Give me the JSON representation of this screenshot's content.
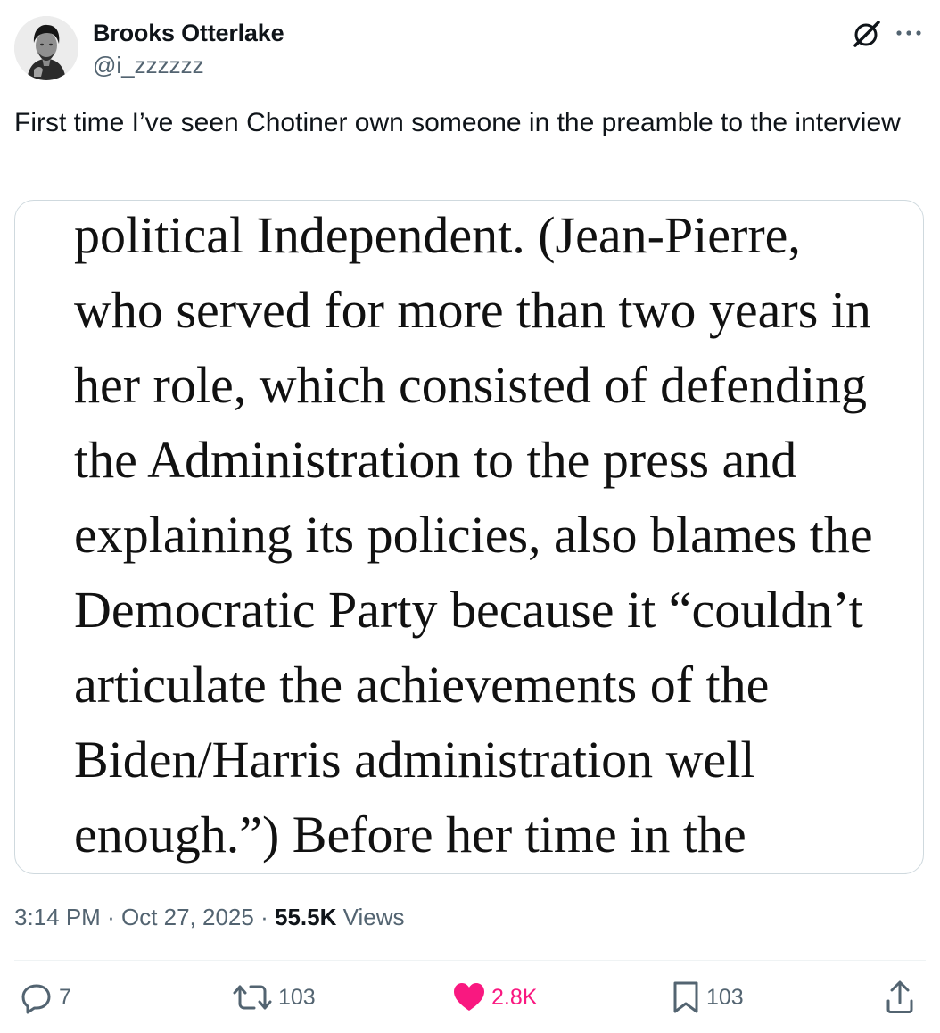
{
  "tweet": {
    "author": {
      "display_name": "Brooks Otterlake",
      "handle": "@i_zzzzzz"
    },
    "text": "First time I’ve seen Chotiner own someone in the preamble to the interview",
    "image_text_lines": [
      "political Independent. (Jean-Pierre,",
      "who served for more than two years in",
      "her role, which consisted of defending",
      "the Administration to the press and",
      "explaining its policies, also blames the",
      "Democratic Party because it “couldn’t",
      "articulate the achievements of the",
      "Biden/Harris administration well",
      "enough.”) Before her time in the"
    ],
    "meta": {
      "time": "3:14 PM",
      "separator": "·",
      "date": "Oct 27, 2025",
      "views_count": "55.5K",
      "views_label": "Views"
    },
    "actions": {
      "replies": "7",
      "reposts": "103",
      "likes": "2.8K",
      "bookmarks": "103"
    }
  },
  "icons": {
    "header_right": [
      "grok-icon",
      "more-icon"
    ],
    "actions": [
      "reply-icon",
      "repost-icon",
      "like-icon",
      "bookmark-icon",
      "share-icon"
    ]
  },
  "colors": {
    "text_primary": "#0f1419",
    "text_secondary": "#536471",
    "like_active": "#f91880",
    "border": "#cfd9de"
  }
}
